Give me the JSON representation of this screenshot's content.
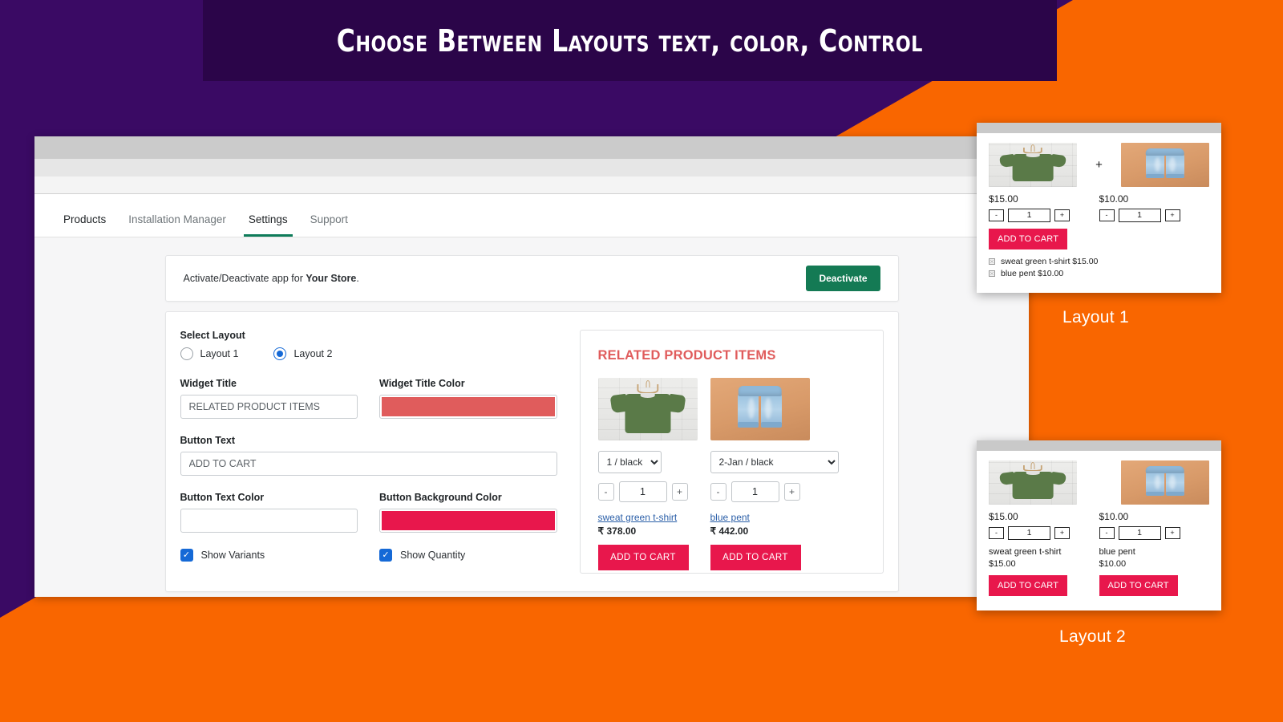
{
  "banner": {
    "title": "Choose Between Layouts text, color, Control"
  },
  "colors": {
    "background_purple": "#3A0A64",
    "background_orange": "#F96600",
    "banner_bg": "#2B0549",
    "accent_green": "#147A54",
    "accent_crimson": "#E8174C",
    "widget_title_color": "#E05C5C",
    "radio_blue": "#1569D6"
  },
  "browser": {
    "nav_tabs": [
      {
        "label": "Products",
        "active": false
      },
      {
        "label": "Installation Manager",
        "active": false
      },
      {
        "label": "Settings",
        "active": true
      },
      {
        "label": "Support",
        "active": false
      }
    ]
  },
  "activate_card": {
    "text_prefix": "Activate/Deactivate app for ",
    "store_name": "Your Store",
    "text_suffix": ".",
    "button_label": "Deactivate"
  },
  "settings_form": {
    "select_layout_label": "Select Layout",
    "layout_options": [
      {
        "label": "Layout 1",
        "selected": false
      },
      {
        "label": "Layout 2",
        "selected": true
      }
    ],
    "widget_title_label": "Widget Title",
    "widget_title_value": "RELATED PRODUCT ITEMS",
    "widget_title_color_label": "Widget Title Color",
    "widget_title_color_value": "#E05C5C",
    "button_text_label": "Button Text",
    "button_text_value": "ADD TO CART",
    "button_text_color_label": "Button Text Color",
    "button_text_color_value": "#FFFFFF",
    "button_bg_color_label": "Button Background Color",
    "button_bg_color_value": "#E8174C",
    "show_variants_label": "Show Variants",
    "show_variants_checked": true,
    "show_quantity_label": "Show Quantity",
    "show_quantity_checked": true,
    "checkmark": "✓"
  },
  "preview": {
    "title": "RELATED PRODUCT ITEMS",
    "products": [
      {
        "image": "green-tshirt-image",
        "variant": "1 / black",
        "qty_minus": "-",
        "qty_value": "1",
        "qty_plus": "+",
        "name": "sweat green t-shirt",
        "price": "₹ 378.00",
        "cart_label": "ADD TO CART"
      },
      {
        "image": "blue-jeans-image",
        "variant": "2-Jan / black",
        "qty_minus": "-",
        "qty_value": "1",
        "qty_plus": "+",
        "name": "blue pent",
        "price": "₹ 442.00",
        "cart_label": "ADD TO CART"
      }
    ]
  },
  "layout1_popup": {
    "caption": "Layout 1",
    "plus_symbol": "+",
    "products": [
      {
        "image": "green-tshirt-image",
        "price": "$15.00",
        "qty_minus": "-",
        "qty_value": "1",
        "qty_plus": "+"
      },
      {
        "image": "blue-jeans-image",
        "price": "$10.00",
        "qty_minus": "-",
        "qty_value": "1",
        "qty_plus": "+"
      }
    ],
    "cart_label": "ADD TO CART",
    "checklist": [
      "sweat green t-shirt $15.00",
      "blue pent $10.00"
    ]
  },
  "layout2_popup": {
    "caption": "Layout 2",
    "products": [
      {
        "image": "green-tshirt-image",
        "price": "$15.00",
        "qty_minus": "-",
        "qty_value": "1",
        "qty_plus": "+",
        "name": "sweat green t-shirt",
        "name_price": "$15.00",
        "cart_label": "ADD TO CART"
      },
      {
        "image": "blue-jeans-image",
        "price": "$10.00",
        "qty_minus": "-",
        "qty_value": "1",
        "qty_plus": "+",
        "name": "blue pent",
        "name_price": "$10.00",
        "cart_label": "ADD TO CART"
      }
    ]
  }
}
